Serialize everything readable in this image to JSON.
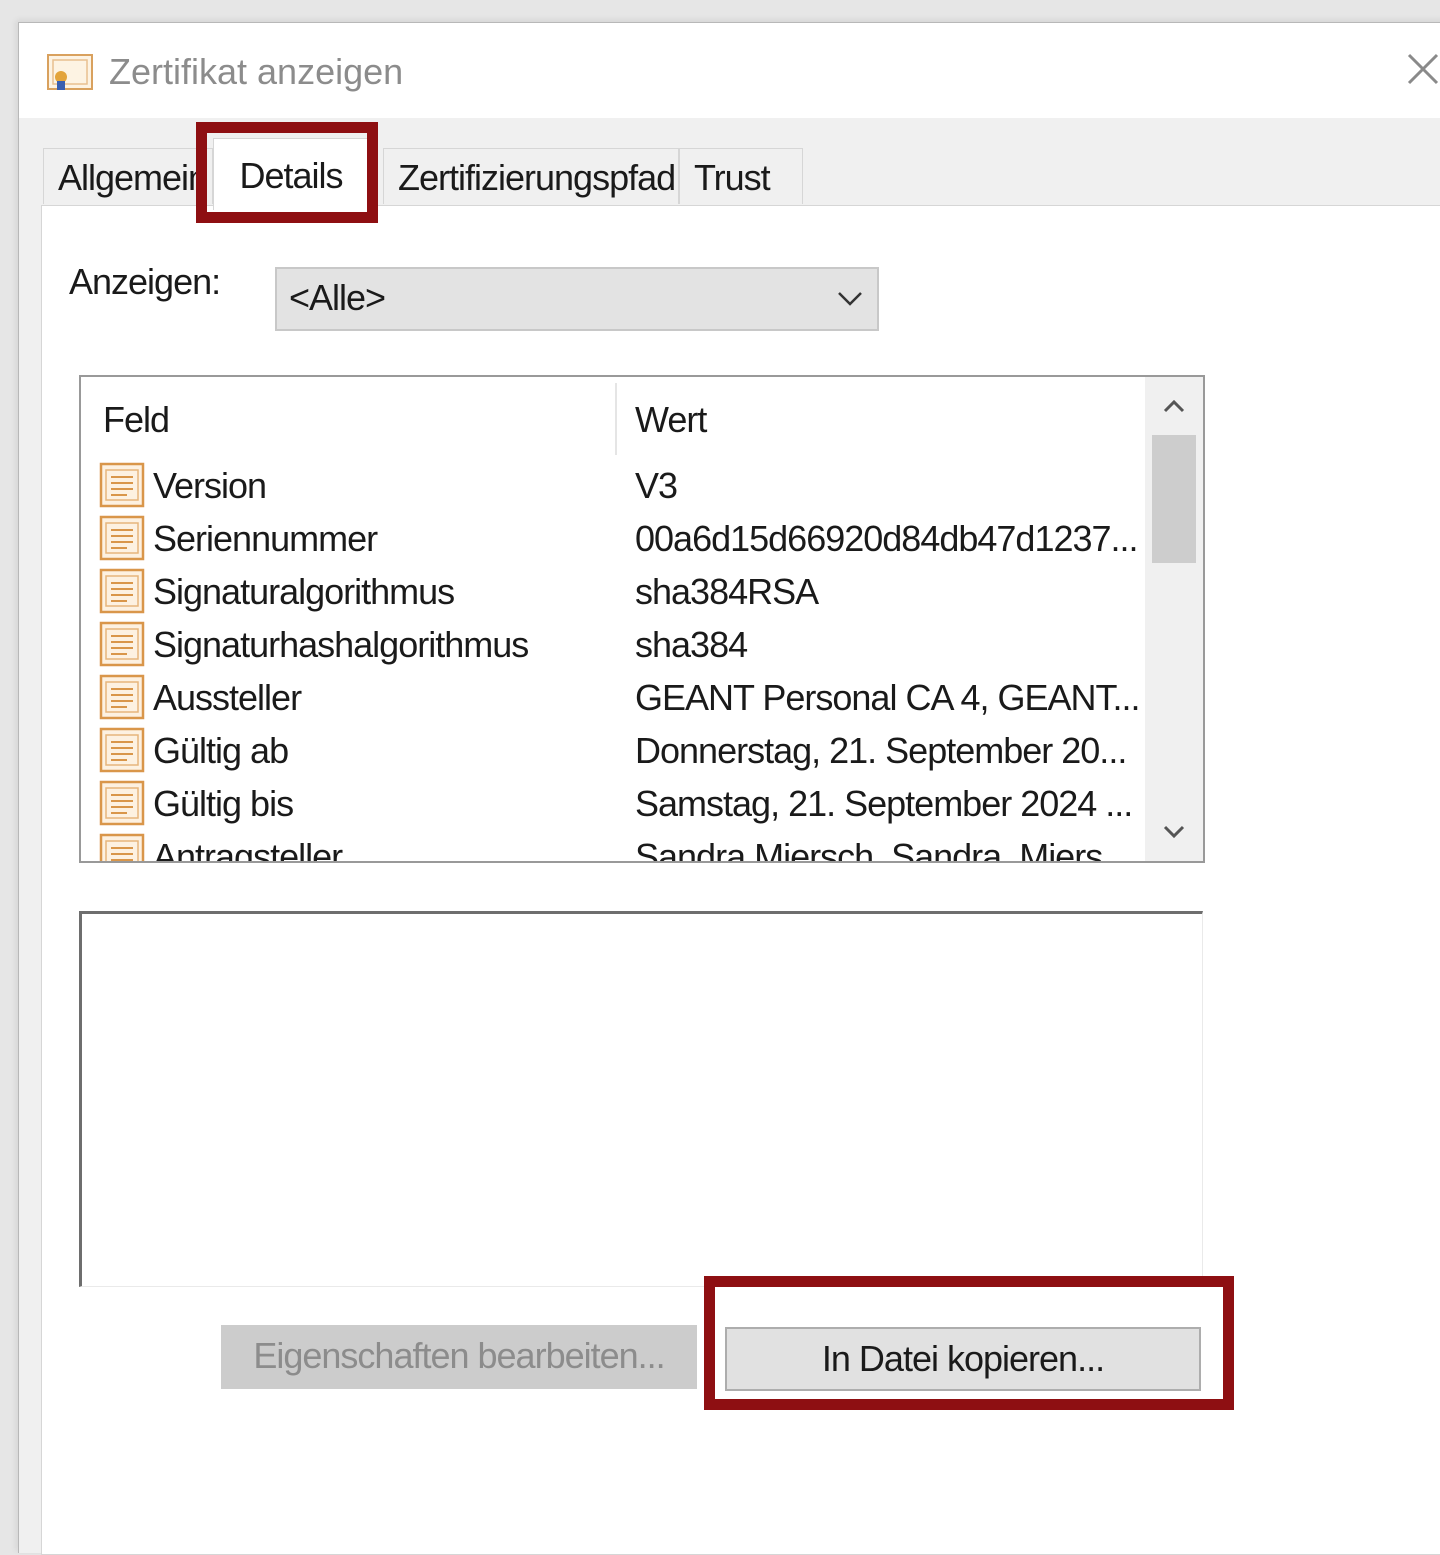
{
  "window": {
    "title": "Zertifikat anzeigen"
  },
  "tabs": [
    {
      "label": "Allgemein"
    },
    {
      "label": "Details",
      "active": true
    },
    {
      "label": "Zertifizierungspfad"
    },
    {
      "label": "Trust"
    }
  ],
  "show": {
    "label": "Anzeigen:",
    "value": "<Alle>"
  },
  "list": {
    "headers": {
      "field": "Feld",
      "value": "Wert"
    },
    "rows": [
      {
        "field": "Version",
        "value": "V3"
      },
      {
        "field": "Seriennummer",
        "value": "00a6d15d66920d84db47d1237..."
      },
      {
        "field": "Signaturalgorithmus",
        "value": "sha384RSA"
      },
      {
        "field": "Signaturhashalgorithmus",
        "value": "sha384"
      },
      {
        "field": "Aussteller",
        "value": "GEANT Personal CA 4, GEANT..."
      },
      {
        "field": "Gültig ab",
        "value": "Donnerstag, 21. September 20..."
      },
      {
        "field": "Gültig bis",
        "value": "Samstag, 21. September 2024 ..."
      },
      {
        "field": "Antragsteller",
        "value": "Sandra Miersch, Sandra, Miers"
      }
    ]
  },
  "buttons": {
    "edit_properties": "Eigenschaften bearbeiten...",
    "copy_to_file": "In Datei kopieren..."
  },
  "colors": {
    "highlight": "#8e0f12",
    "icon": "#e0a05a"
  }
}
